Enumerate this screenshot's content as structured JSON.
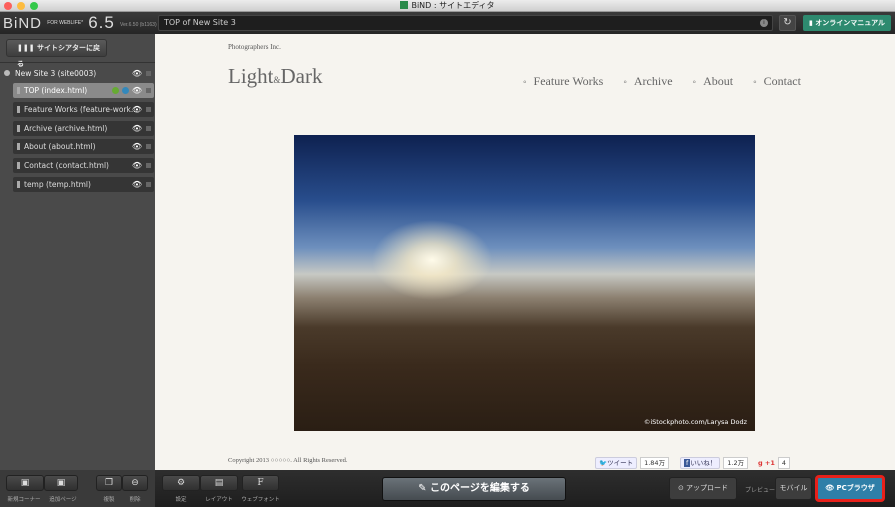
{
  "window": {
    "title": "BiND : サイトエディタ"
  },
  "toolbar": {
    "logo": "BiND",
    "logo_sub": "FOR WEBLIFE*",
    "version": "6.5",
    "build": "Ver.6.50 (b1163)",
    "url": "TOP of New Site 3",
    "manual": "オンラインマニュアル"
  },
  "sidebar": {
    "back": "サイトシアターに戻る",
    "site": "New Site 3 (site0003)",
    "pages": [
      {
        "label": "TOP (index.html)"
      },
      {
        "label": "Feature Works (feature-work..."
      },
      {
        "label": "Archive (archive.html)"
      },
      {
        "label": "About (about.html)"
      },
      {
        "label": "Contact (contact.html)"
      },
      {
        "label": "temp (temp.html)"
      }
    ]
  },
  "page": {
    "company": "Photographers Inc.",
    "brand_a": "Light",
    "brand_amp": "&",
    "brand_b": "Dark",
    "nav": [
      "Feature Works",
      "Archive",
      "About",
      "Contact"
    ],
    "credit": "©iStockphoto.com/Larysa Dodz",
    "copyright": "Copyright 2013 ○○○○○. All Rights Reserved.",
    "social": {
      "tweet": "ツイート",
      "tweet_count": "1.84万",
      "like": "いいね！",
      "like_count": "1.2万",
      "gplus": "+1",
      "gplus_count": "4"
    }
  },
  "bottom": {
    "new_corner": "新規コーナー",
    "add_page": "追加ページ",
    "duplicate": "複製",
    "delete": "削除",
    "settings": "設定",
    "layout": "レイアウト",
    "webfont": "ウェブフォント",
    "edit": "このページを編集する",
    "upload": "アップロード",
    "preview": "プレビュー",
    "mobile": "モバイル",
    "pc": "PCブラウザ"
  },
  "colors": {
    "accent_manual": "#2d8a6f",
    "pc_button": "#2f7fa8",
    "highlight": "#e8201a"
  }
}
